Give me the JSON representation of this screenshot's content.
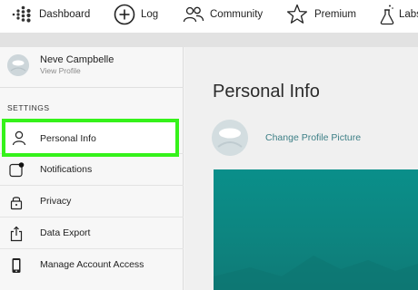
{
  "nav": {
    "items": [
      {
        "label": "Dashboard",
        "icon": "fitbit-dots-icon"
      },
      {
        "label": "Log",
        "icon": "plus-circle-icon"
      },
      {
        "label": "Community",
        "icon": "people-icon"
      },
      {
        "label": "Premium",
        "icon": "star-icon"
      },
      {
        "label": "Labs",
        "icon": "flask-icon"
      }
    ]
  },
  "profile": {
    "name": "Neve Campbelle",
    "sub": "View Profile"
  },
  "sidebar": {
    "heading": "SETTINGS",
    "items": [
      {
        "label": "Personal Info",
        "icon": "person-icon",
        "active": true
      },
      {
        "label": "Notifications",
        "icon": "notification-icon"
      },
      {
        "label": "Privacy",
        "icon": "lock-icon"
      },
      {
        "label": "Data Export",
        "icon": "export-icon"
      },
      {
        "label": "Manage Account Access",
        "icon": "phone-icon"
      }
    ]
  },
  "main": {
    "title": "Personal Info",
    "change_picture": "Change Profile Picture"
  },
  "colors": {
    "highlight": "#35f21a",
    "link": "#3d7f86",
    "banner": "#0a8f8a"
  }
}
